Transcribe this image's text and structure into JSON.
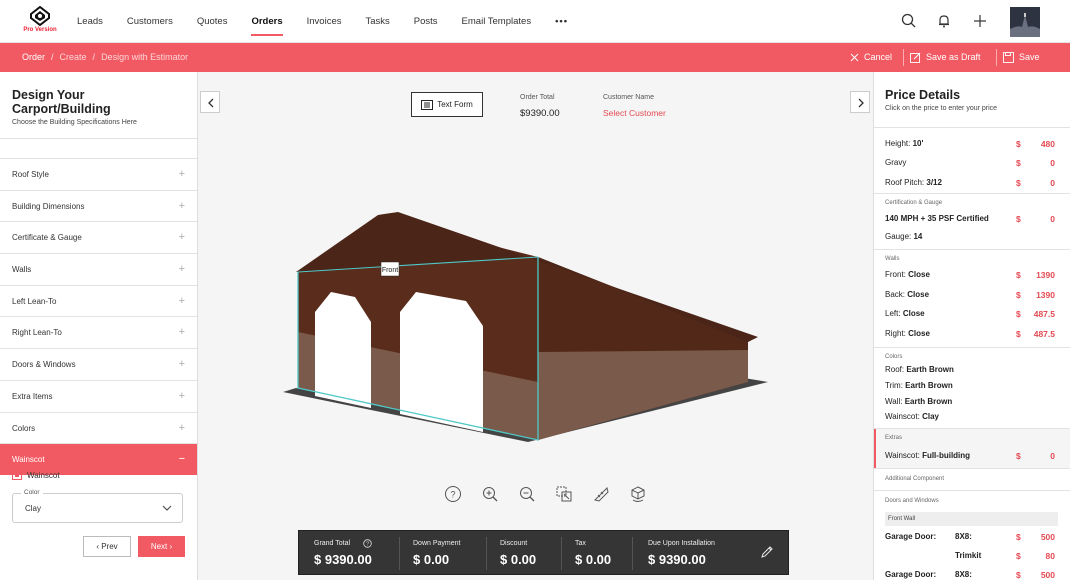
{
  "app": {
    "pro_label": "Pro Version"
  },
  "nav": {
    "items": [
      "Leads",
      "Customers",
      "Quotes",
      "Orders",
      "Invoices",
      "Tasks",
      "Posts",
      "Email Templates"
    ],
    "active": "Orders",
    "more": "•••"
  },
  "breadcrumb": {
    "items": [
      "Order",
      "Create",
      "Design with Estimator"
    ]
  },
  "actions": {
    "cancel": "Cancel",
    "save_draft": "Save as Draft",
    "save": "Save"
  },
  "left": {
    "title": "Design Your Carport/Building",
    "subtitle": "Choose the Building Specifications Here",
    "sections": [
      "Roof Style",
      "Building Dimensions",
      "Certificate & Gauge",
      "Walls",
      "Left Lean-To",
      "Right Lean-To",
      "Doors & Windows",
      "Extra Items",
      "Colors",
      "Wainscot"
    ],
    "active_section": "Wainscot",
    "wainscot_label": "Wainscot",
    "color_label": "Color",
    "color_value": "Clay",
    "prev": "Prev",
    "next": "Next"
  },
  "center": {
    "text_form": "Text Form",
    "order_total_label": "Order Total",
    "order_total_value": "$9390.00",
    "customer_label": "Customer Name",
    "customer_value": "Select Customer",
    "model_tag": "Front",
    "colors": {
      "roof": "#4a2518",
      "wall": "#5a2c1c",
      "wainscot": "#7a5a4a",
      "door": "#ffffff",
      "accent": "#f25a63"
    }
  },
  "totals": {
    "grand_total_label": "Grand Total",
    "grand_total": "$ 9390.00",
    "down_payment_label": "Down Payment",
    "down_payment": "$ 0.00",
    "discount_label": "Discount",
    "discount": "$ 0.00",
    "tax_label": "Tax",
    "tax": "$ 0.00",
    "due_label": "Due Upon Installation",
    "due": "$ 9390.00"
  },
  "price": {
    "title": "Price Details",
    "subtitle": "Click on the price to enter your price",
    "currency": "$",
    "height": {
      "label": "Height:",
      "value": "10'",
      "amount": "480"
    },
    "gravy": {
      "label": "Gravy",
      "amount": "0"
    },
    "pitch": {
      "label": "Roof Pitch:",
      "value": "3/12",
      "amount": "0"
    },
    "cert_header": "Certification & Gauge",
    "cert": {
      "label": "140 MPH + 35 PSF Certified",
      "amount": "0"
    },
    "gauge": {
      "label": "Gauge:",
      "value": "14"
    },
    "walls_header": "Walls",
    "front": {
      "label": "Front:",
      "value": "Close",
      "amount": "1390"
    },
    "back": {
      "label": "Back:",
      "value": "Close",
      "amount": "1390"
    },
    "leftw": {
      "label": "Left:",
      "value": "Close",
      "amount": "487.5"
    },
    "rightw": {
      "label": "Right:",
      "value": "Close",
      "amount": "487.5"
    },
    "colors_header": "Colors",
    "roof": {
      "label": "Roof:",
      "value": "Earth Brown"
    },
    "trim": {
      "label": "Trim:",
      "value": "Earth Brown"
    },
    "wall": {
      "label": "Wall:",
      "value": "Earth Brown"
    },
    "wainscot": {
      "label": "Wainscot:",
      "value": "Clay"
    },
    "extras_header": "Extras",
    "extra_wainscot": {
      "label": "Wainscot:",
      "value": "Full-building",
      "amount": "0"
    },
    "additional_header": "Additional Component",
    "doors_header": "Doors and Windows",
    "front_wall": "Front Wall",
    "garage1": {
      "label": "Garage Door:",
      "value": "8X8:",
      "amount": "500"
    },
    "trimkit": {
      "label": "Trimkit",
      "amount": "80"
    },
    "garage2": {
      "label": "Garage Door:",
      "value": "8X8:",
      "amount": "500"
    }
  }
}
